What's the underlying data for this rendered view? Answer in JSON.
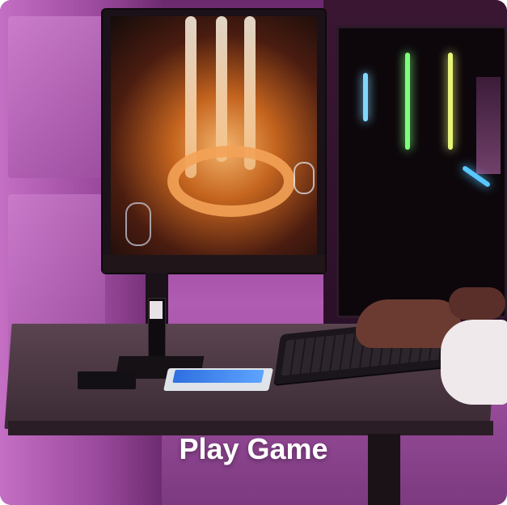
{
  "caption": {
    "text": "Play Game"
  },
  "colors": {
    "ambient_light": "#b15cb3",
    "rgb_green": "#7cff7a",
    "rgb_yellow": "#e9f57a",
    "rgb_cyan": "#7fd8ff",
    "ssd_blue": "#2f6fe0",
    "caption_text": "#ffffff"
  },
  "scene": {
    "objects": [
      "monitor-icon",
      "pc-case-icon",
      "keyboard-icon",
      "ssd-icon",
      "enclosure-icon",
      "hand-icon"
    ]
  }
}
